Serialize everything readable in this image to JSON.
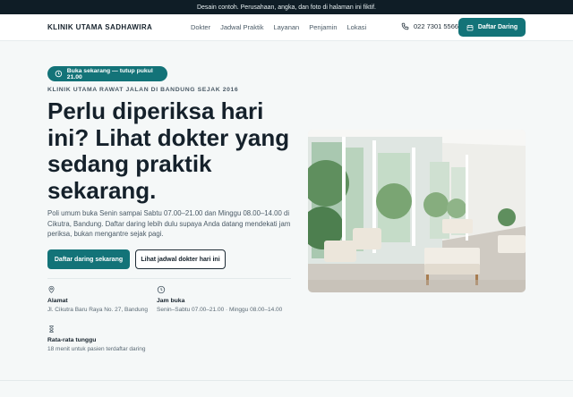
{
  "topbar": {
    "notice": "Desain contoh. Perusahaan, angka, dan foto di halaman ini fiktif."
  },
  "nav": {
    "brand": "KLINIK UTAMA SADHAWIRA",
    "items": [
      "Dokter",
      "Jadwal Praktik",
      "Layanan",
      "Penjamin",
      "Lokasi"
    ],
    "phone": "022 7301 5566",
    "cta": "Daftar Daring"
  },
  "hero": {
    "badge": "Buka sekarang — tutup pukul 21.00",
    "eyebrow": "KLINIK UTAMA RAWAT JALAN DI BANDUNG SEJAK 2016",
    "headline": "Perlu diperiksa hari ini? Lihat dokter yang sedang praktik sekarang.",
    "lead": "Poli umum buka Senin sampai Sabtu 07.00–21.00 dan Minggu 08.00–14.00 di Cikutra, Bandung. Daftar daring lebih dulu supaya Anda datang mendekati jam periksa, bukan mengantre sejak pagi.",
    "primary_button": "Daftar daring sekarang",
    "secondary_button": "Lihat jadwal dokter hari ini"
  },
  "info": {
    "address": {
      "title": "Alamat",
      "detail": "Jl. Cikutra Baru Raya No. 27, Bandung"
    },
    "hours": {
      "title": "Jam buka",
      "detail": "Senin–Sabtu 07.00–21.00 · Minggu 08.00–14.00"
    },
    "wait": {
      "title": "Rata-rata tunggu",
      "detail": "18 menit untuk pasien terdaftar daring"
    }
  },
  "colors": {
    "accent": "#137378",
    "dark": "#0f1d26",
    "text": "#15212b",
    "muted": "#4a5a66"
  }
}
